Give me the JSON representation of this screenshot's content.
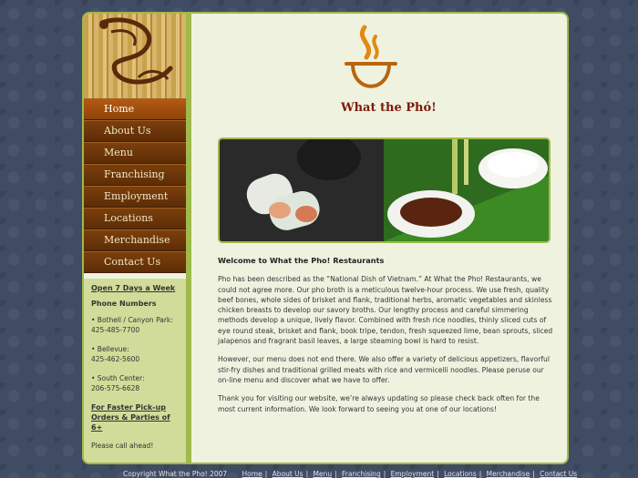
{
  "brand": {
    "name": "What the Phó!"
  },
  "nav": [
    {
      "label": "Home",
      "active": true
    },
    {
      "label": "About Us"
    },
    {
      "label": "Menu"
    },
    {
      "label": "Franchising"
    },
    {
      "label": "Employment"
    },
    {
      "label": "Locations"
    },
    {
      "label": "Merchandise"
    },
    {
      "label": "Contact Us"
    }
  ],
  "sidebar": {
    "open_days": "Open 7 Days a Week",
    "phone_heading": "Phone Numbers",
    "locations": [
      {
        "name": "• Bothell / Canyon Park:",
        "phone": "425-485-7700"
      },
      {
        "name": "• Bellevue:",
        "phone": "425-462-5600"
      },
      {
        "name": "• South Center:",
        "phone": "206-575-6628"
      }
    ],
    "pickup": "For Faster Pick-up Orders & Parties of 6+",
    "call_ahead": "Please call ahead!"
  },
  "main": {
    "heading": "Welcome to What the Pho! Restaurants",
    "paragraphs": [
      "Pho has been described as the “National Dish of Vietnam.” At What the Pho! Restaurants, we could not agree more. Our pho broth is a meticulous twelve-hour process. We use fresh, quality beef bones, whole sides of brisket and flank, traditional herbs, aromatic vegetables and skinless chicken breasts to develop our savory broths. Our lengthy process and careful simmering methods develop a unique, lively flavor. Combined with fresh rice noodles, thinly sliced cuts of eye round steak, brisket and flank, book tripe, tendon, fresh squeezed lime, bean sprouts, sliced jalapenos and fragrant basil leaves, a large steaming bowl is hard to resist.",
      "However, our menu does not end there. We also offer a variety of delicious appetizers, flavorful stir-fry dishes and traditional grilled meats with rice and vermicelli noodles. Please peruse our on-line menu and discover what we have to offer.",
      "Thank you for visiting our website, we’re always updating so please check back often for the most current information. We look forward to seeing you at one of our locations!"
    ]
  },
  "footer": {
    "copyright": "Copyright What the Pho! 2007",
    "links": [
      "Home",
      "About Us",
      "Menu",
      "Franchising",
      "Employment",
      "Locations",
      "Merchandise",
      "Contact Us"
    ]
  },
  "colors": {
    "accent": "#9fb94a",
    "nav_brown": "#6b330a",
    "nav_active": "#a3500f",
    "brand_red": "#7a1a0c"
  }
}
